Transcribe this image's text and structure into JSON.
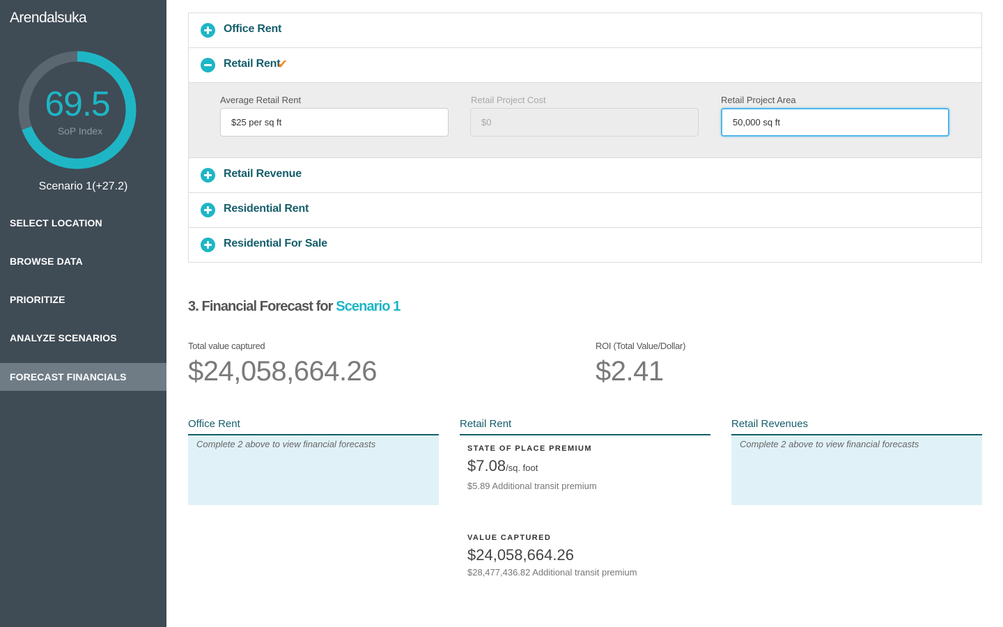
{
  "sidebar": {
    "brand": "Arendalsuka",
    "gauge": {
      "score": "69.5",
      "label": "SoP Index",
      "fraction": 0.695,
      "track_color": "#5a6770",
      "fill_color": "#1eb6c5"
    },
    "scenario": "Scenario 1(+27.2)",
    "nav": [
      {
        "label": "SELECT LOCATION",
        "active": false
      },
      {
        "label": "BROWSE DATA",
        "active": false
      },
      {
        "label": "PRIORITIZE",
        "active": false
      },
      {
        "label": "ANALYZE SCENARIOS",
        "active": false
      },
      {
        "label": "FORECAST FINANCIALS",
        "active": true
      }
    ]
  },
  "accordion": {
    "items": [
      {
        "title": "Office Rent",
        "expanded": false,
        "icon": "plus-icon"
      },
      {
        "title": "Retail Rent",
        "expanded": true,
        "icon": "minus-icon",
        "completed": true,
        "check_icon": "checkmark-icon",
        "check_glyph": "✔"
      },
      {
        "title": "Retail Revenue",
        "expanded": false,
        "icon": "plus-icon"
      },
      {
        "title": "Residential Rent",
        "expanded": false,
        "icon": "plus-icon"
      },
      {
        "title": "Residential For Sale",
        "expanded": false,
        "icon": "plus-icon"
      }
    ],
    "retail_fields": {
      "avg_rent": {
        "label": "Average Retail Rent",
        "value": "$25 per sq ft",
        "disabled": false
      },
      "project_cost": {
        "label": "Retail Project Cost",
        "value": "$0",
        "disabled": true
      },
      "project_area": {
        "label": "Retail Project Area",
        "value": "50,000 sq ft",
        "focused": true
      }
    }
  },
  "forecast": {
    "title_prefix": "3. Financial Forecast for",
    "title_highlight": "Scenario 1",
    "total_label": "Total value captured",
    "total_value": "$24,058,664.26",
    "roi_label": "ROI (Total Value/Dollar)",
    "roi_value": "$2.41",
    "cards": {
      "office": {
        "title": "Office Rent",
        "empty_text": "Complete 2 above to view financial forecasts"
      },
      "retail": {
        "title": "Retail Rent",
        "premium_label": "STATE OF PLACE PREMIUM",
        "premium_value": "$7.08",
        "premium_unit": "/sq. foot",
        "premium_transit": "$5.89 Additional transit premium",
        "captured_label": "VALUE CAPTURED",
        "captured_value": "$24,058,664.26",
        "captured_transit": "$28,477,436.82 Additional transit premium"
      },
      "revenues": {
        "title": "Retail Revenues",
        "empty_text": "Complete 2 above to view financial forecasts"
      }
    }
  }
}
